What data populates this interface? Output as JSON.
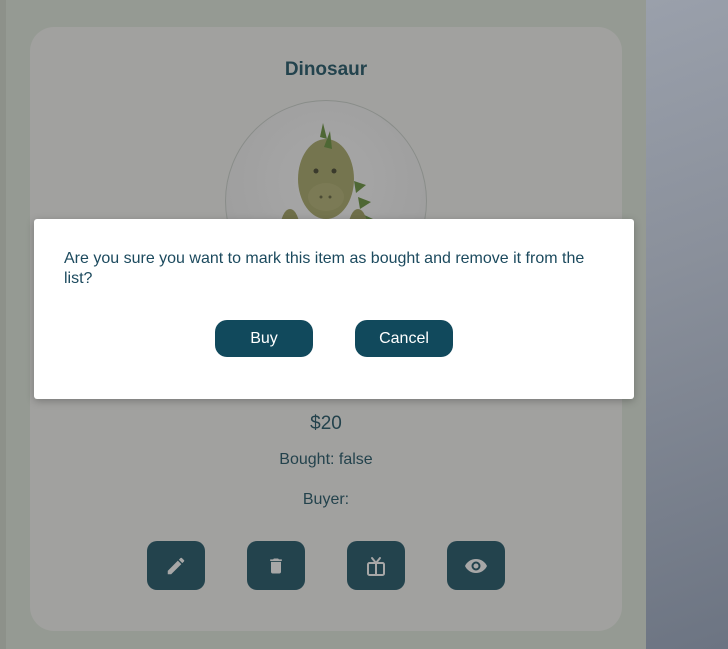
{
  "card": {
    "title": "Dinosaur",
    "image_alt": "green plush dinosaur toy",
    "price": "$20",
    "bought": "Bought: false",
    "buyer": "Buyer:",
    "actions": [
      {
        "name": "edit",
        "icon": "pencil-icon"
      },
      {
        "name": "delete",
        "icon": "trash-icon"
      },
      {
        "name": "gift",
        "icon": "gift-icon"
      },
      {
        "name": "view",
        "icon": "eye-icon"
      }
    ]
  },
  "modal": {
    "message": "Are you sure you want to mark this item as bought and remove it from the list?",
    "buy_label": "Buy",
    "cancel_label": "Cancel"
  },
  "colors": {
    "primary": "#0f4a5c",
    "card_bg": "#f4f4f1",
    "page_bg": "#dfe8da"
  }
}
